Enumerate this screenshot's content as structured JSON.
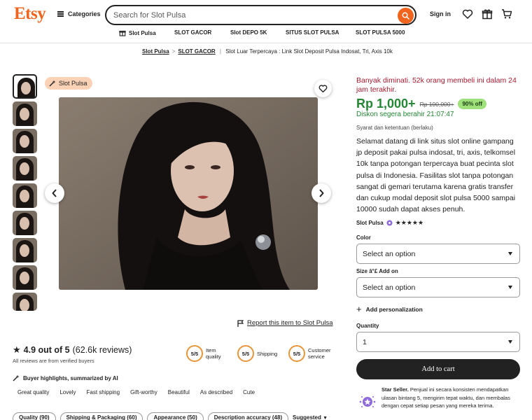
{
  "header": {
    "logo": "Etsy",
    "categories_label": "Categories",
    "search_placeholder": "Search for Slot Pulsa",
    "signin_label": "Sign in",
    "subnav": [
      "Slot Pulsa",
      "SLOT GACOR",
      "Slot DEPO 5K",
      "SITUS SLOT PULSA",
      "SLOT PULSA 5000"
    ]
  },
  "breadcrumb": {
    "item1": "Slot Pulsa",
    "item2": "SLOT GACOR",
    "current": "Slot Luar Terpercaya : Link Slot Deposit Pulsa Indosat, Tri, Axis 10k"
  },
  "gallery": {
    "badge": "Slot Pulsa",
    "thumbnail_count": 9,
    "report_label": "Report this item to Slot Pulsa"
  },
  "reviews": {
    "rating_text": "4.9 out of 5",
    "count_text": "(62.6k reviews)",
    "verified_text": "All reviews are from verified buyers",
    "metrics": [
      {
        "score": "5/5",
        "label": "Item quality"
      },
      {
        "score": "5/5",
        "label": "Shipping"
      },
      {
        "score": "5/5",
        "label": "Customer service"
      }
    ],
    "highlights_title": "Buyer highlights, summarized by AI",
    "tags": [
      "Great quality",
      "Lovely",
      "Fast shipping",
      "Gift-worthy",
      "Beautiful",
      "As described",
      "Cute"
    ],
    "filters": [
      "Quality (90)",
      "Shipping & Packaging (60)",
      "Appearance (50)",
      "Description accuracy (48)"
    ],
    "sort_label": "Suggested"
  },
  "product": {
    "demand_text": "Banyak diminati. 52k orang membeli ini dalam 24 jam terakhir.",
    "price": "Rp 1,000+",
    "old_price": "Rp 100,000+",
    "discount": "90% off",
    "sale_end": "Diskon segera berahir 21:07:47",
    "terms": "Syarat dan ketentuan (berlaku)",
    "description": "Selamat datang di link situs slot online gampang jp deposit pakai pulsa indosat, tri, axis, telkomsel 10k tanpa potongan terpercaya buat pecinta slot pulsa di Indonesia. Fasilitas slot tanpa potongan sangat di gemari terutama karena gratis transfer dan cukup modal deposit slot pulsa 5000 sampai 10000 sudah dapat akses penuh.",
    "shop_name": "Slot Pulsa",
    "stars": "★★★★★",
    "color_label": "Color",
    "color_value": "Select an option",
    "size_label": "Size â°£ Add on",
    "size_value": "Select an option",
    "personalization_label": "Add personalization",
    "quantity_label": "Quantity",
    "quantity_value": "1",
    "cart_label": "Add to cart",
    "star_seller_title": "Star Seller.",
    "star_seller_text": " Penjual ini secara konsisten mendapatkan ulasan bintang 5, mengirim tepat waktu, dan membalas dengan cepat setiap pesan yang mereka terima."
  },
  "colors": {
    "brand": "#f1641e",
    "price_green": "#258635",
    "demand_red": "#a61a2e",
    "discount_bg": "#9ee07a",
    "badge_bg": "#fbd2b5",
    "metric_ring": "#e8963c"
  }
}
